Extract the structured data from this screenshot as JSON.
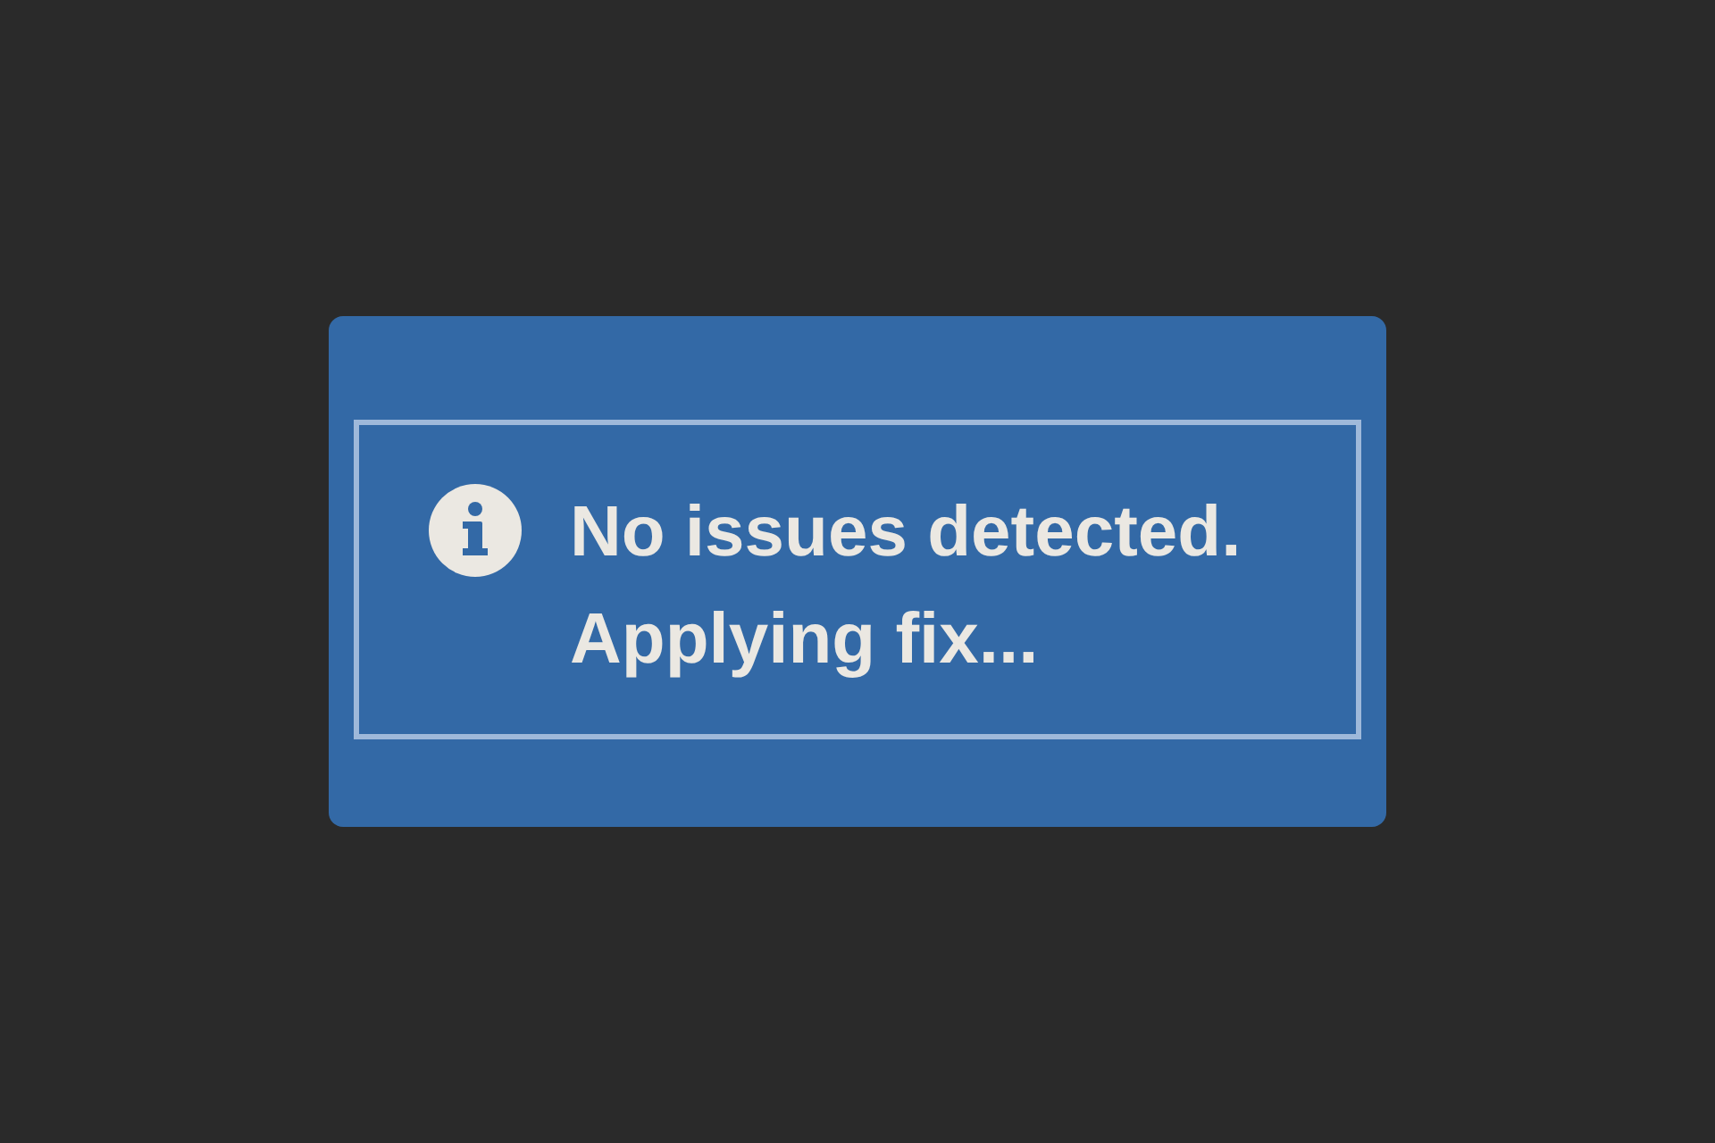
{
  "notice": {
    "lines": [
      "No issues detected.",
      "Applying fix..."
    ]
  }
}
